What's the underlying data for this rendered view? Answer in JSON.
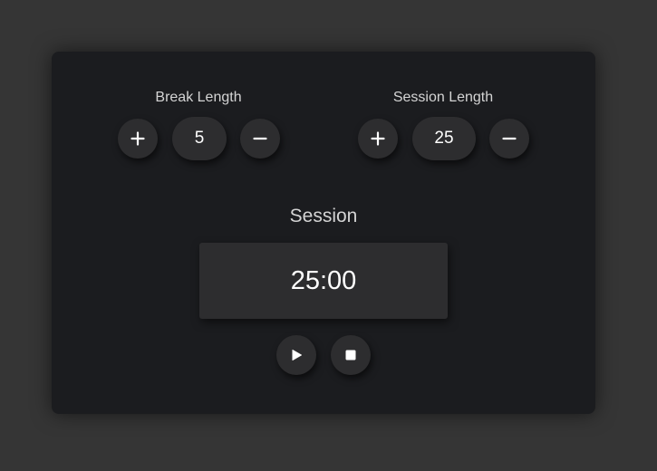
{
  "break_control": {
    "label": "Break Length",
    "value": "5"
  },
  "session_control": {
    "label": "Session Length",
    "value": "25"
  },
  "timer": {
    "label": "Session",
    "display": "25:00"
  },
  "icons": {
    "increment": "plus-icon",
    "decrement": "minus-icon",
    "play": "play-icon",
    "stop": "stop-icon"
  },
  "colors": {
    "page_background": "#353535",
    "card_background": "#1b1c1f",
    "control_background": "#2d2d2f",
    "text_primary": "#ffffff",
    "text_secondary": "#d4d4d4"
  }
}
